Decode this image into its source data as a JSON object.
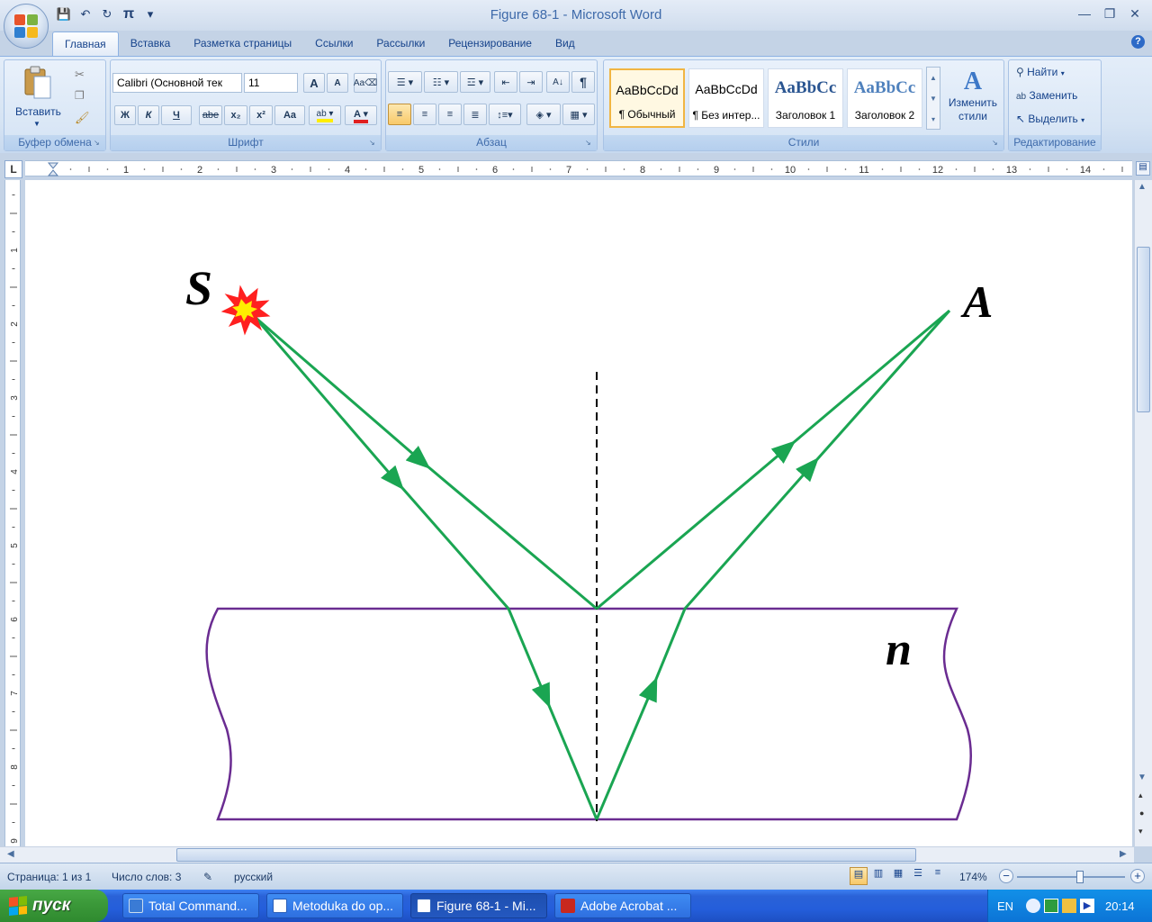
{
  "window": {
    "title": "Figure 68-1 - Microsoft Word",
    "controls": [
      "—",
      "❐",
      "✕"
    ]
  },
  "qat": {
    "save": "💾",
    "undo": "↶",
    "redo": "↻",
    "pi": "π",
    "more": "▾"
  },
  "tabs": [
    "Главная",
    "Вставка",
    "Разметка страницы",
    "Ссылки",
    "Рассылки",
    "Рецензирование",
    "Вид"
  ],
  "ribbon": {
    "clipboard": {
      "label": "Буфер обмена",
      "paste": "Вставить"
    },
    "font": {
      "label": "Шрифт",
      "font_name": "Calibri (Основной тек",
      "font_size": "11",
      "bold": "Ж",
      "italic": "К",
      "underline": "Ч",
      "strike": "abe",
      "subscript": "x₂",
      "superscript": "x²",
      "case": "Aa",
      "grow": "A",
      "shrink": "A"
    },
    "paragraph": {
      "label": "Абзац",
      "pilcrow": "¶"
    },
    "styles": {
      "label": "Стили",
      "items": [
        {
          "sample": "AaBbCcDd",
          "name": "¶ Обычный"
        },
        {
          "sample": "AaBbCcDd",
          "name": "¶ Без интер..."
        },
        {
          "sample": "AaBbCc",
          "name": "Заголовок 1"
        },
        {
          "sample": "AaBbCc",
          "name": "Заголовок 2"
        }
      ],
      "change_styles": "Изменить стили"
    },
    "editing": {
      "label": "Редактирование",
      "find": "Найти",
      "replace": "Заменить",
      "select": "Выделить"
    }
  },
  "ruler": {
    "corner": "L",
    "h_numbers": [
      "1",
      "2",
      "3",
      "4",
      "5",
      "6",
      "7",
      "8",
      "9",
      "10",
      "11",
      "12",
      "13",
      "14"
    ],
    "v_numbers": [
      "1",
      "2",
      "3",
      "4",
      "5",
      "6",
      "7",
      "8",
      "9"
    ]
  },
  "figure": {
    "source_label": "S",
    "observer_label": "A",
    "medium_label": "n",
    "colors": {
      "ray": "#1aa552",
      "slab": "#6a2c91",
      "normal": "#000000",
      "star_outer": "#ff2020",
      "star_inner": "#ffee00"
    }
  },
  "status": {
    "page": "Страница: 1 из 1",
    "words": "Число слов: 3",
    "language": "русский",
    "zoom": "174%"
  },
  "taskbar": {
    "start": "пуск",
    "items": [
      {
        "label": "Total Command...",
        "color": "#3a7bd5"
      },
      {
        "label": "Metoduka do op...",
        "color": "#2b5fb8"
      },
      {
        "label": "Figure 68-1 - Mi...",
        "color": "#2b5fb8"
      },
      {
        "label": "Adobe Acrobat ...",
        "color": "#c8281e"
      }
    ],
    "lang": "EN",
    "time": "20:14"
  }
}
